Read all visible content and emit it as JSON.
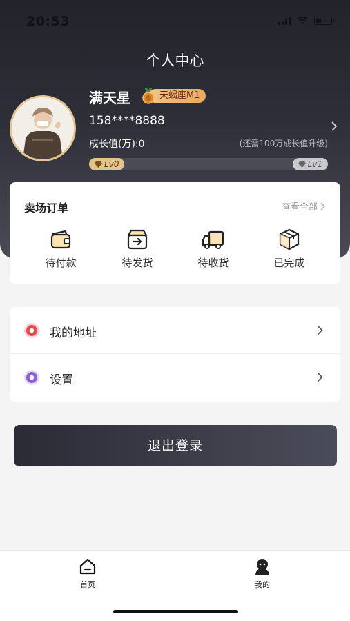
{
  "status_bar": {
    "time": "20:53"
  },
  "header": {
    "title": "个人中心"
  },
  "profile": {
    "name": "满天星",
    "badge": "天蝎座M1",
    "phone": "158****8888",
    "growth_label": "成长值(万):0",
    "upgrade_tip": "(还需100万成长值升级)",
    "level_start": "Lv0",
    "level_end": "Lv1",
    "progress_fraction": 0
  },
  "orders": {
    "title": "卖场订单",
    "view_all": "查看全部",
    "items": [
      {
        "label": "待付款",
        "icon": "wallet-icon"
      },
      {
        "label": "待发货",
        "icon": "ship-box-icon"
      },
      {
        "label": "待收货",
        "icon": "truck-icon"
      },
      {
        "label": "已完成",
        "icon": "package-done-icon"
      }
    ]
  },
  "menu": {
    "items": [
      {
        "label": "我的地址",
        "icon": "location-icon",
        "color": "#e8474f"
      },
      {
        "label": "设置",
        "icon": "settings-icon",
        "color": "#8a62d6"
      }
    ]
  },
  "logout": {
    "label": "退出登录"
  },
  "tabbar": {
    "items": [
      {
        "label": "首页",
        "icon": "home-icon"
      },
      {
        "label": "我的",
        "icon": "user-icon"
      }
    ]
  },
  "colors": {
    "accent_gold": "#e3c48c",
    "dark": "#2a2b35"
  }
}
